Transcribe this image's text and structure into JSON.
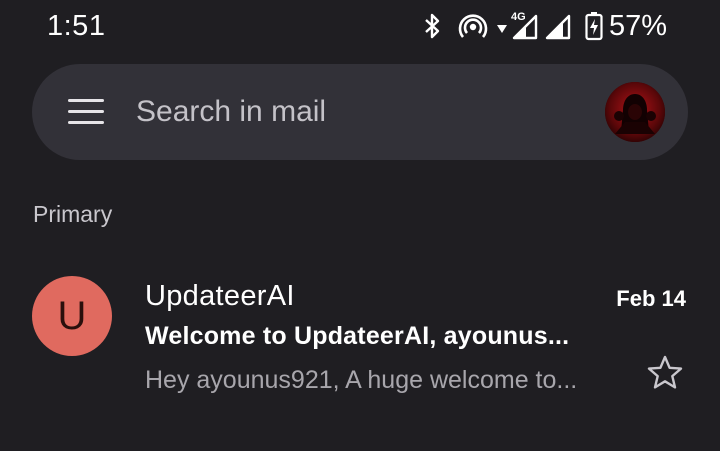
{
  "status_bar": {
    "time": "1:51",
    "network_type": "4G",
    "battery_percent": "57%",
    "icons": [
      "bluetooth-icon",
      "hotspot-icon",
      "data-arrow-icon",
      "signal-icon",
      "signal-icon",
      "battery-charging-icon"
    ]
  },
  "search": {
    "placeholder": "Search in mail",
    "menu_icon": "menu-icon",
    "avatar_icon": "account-avatar"
  },
  "section": {
    "label": "Primary"
  },
  "mails": [
    {
      "avatar_letter": "U",
      "avatar_color": "#e06a5f",
      "sender": "UpdateerAI",
      "date": "Feb 14",
      "subject": "Welcome to UpdateerAI, ayounus...",
      "snippet": "Hey ayounus921, A huge welcome to...",
      "starred": false
    }
  ],
  "colors": {
    "background": "#1f1e22",
    "search_bar": "#323138",
    "text_primary": "#ffffff",
    "text_secondary": "#a8a6ac"
  }
}
